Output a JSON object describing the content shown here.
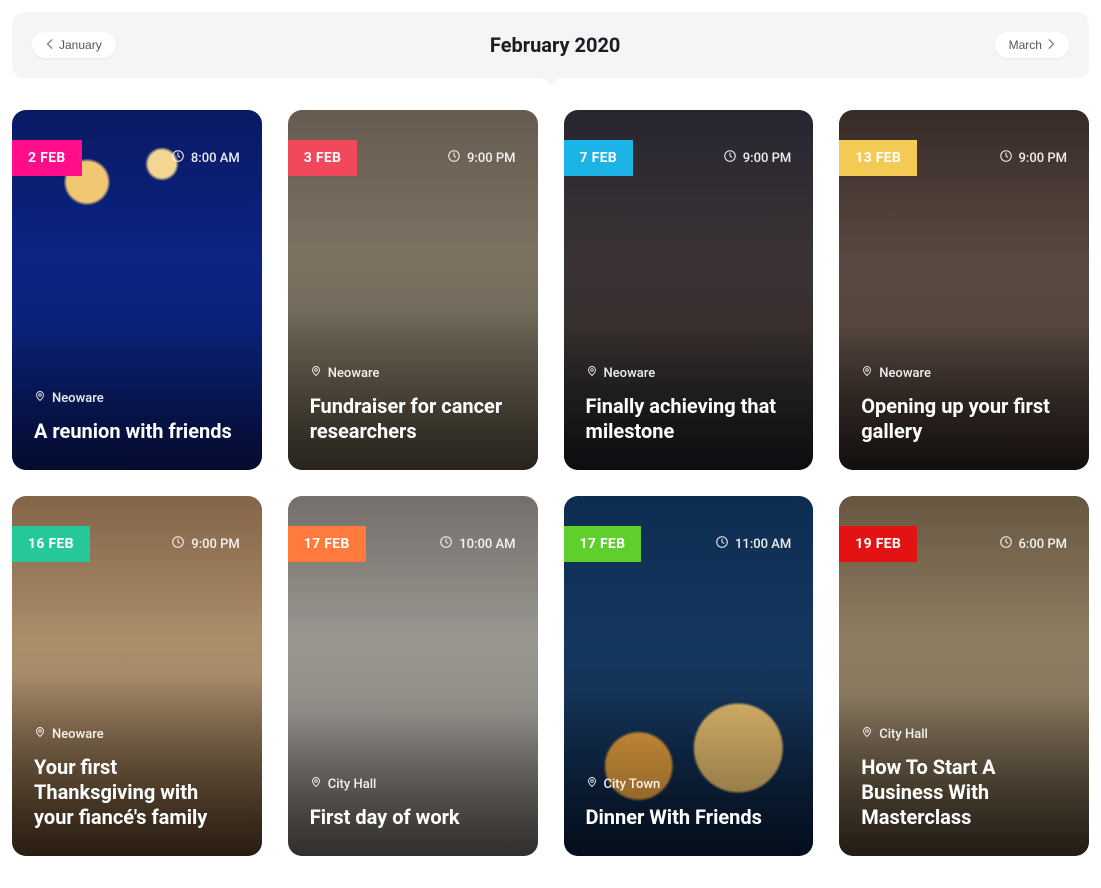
{
  "header": {
    "prev_label": "January",
    "title": "February 2020",
    "next_label": "March"
  },
  "tag_colors": {
    "pink": "#ff0d8a",
    "coral": "#f2485c",
    "blue": "#1cb3e6",
    "gold": "#f3ca53",
    "teal": "#26c89a",
    "orange": "#ff7a3c",
    "green": "#5fcf2e",
    "red": "#e41313"
  },
  "events": [
    {
      "date": "2 FEB",
      "time": "8:00 AM",
      "location": "Neoware",
      "title": "A reunion with friends",
      "color_key": "pink",
      "bg": "bg0"
    },
    {
      "date": "3 FEB",
      "time": "9:00 PM",
      "location": "Neoware",
      "title": "Fundraiser for cancer researchers",
      "color_key": "coral",
      "bg": "bg1"
    },
    {
      "date": "7 FEB",
      "time": "9:00 PM",
      "location": "Neoware",
      "title": "Finally achieving that milestone",
      "color_key": "blue",
      "bg": "bg2"
    },
    {
      "date": "13 FEB",
      "time": "9:00 PM",
      "location": "Neoware",
      "title": "Opening up your first gallery",
      "color_key": "gold",
      "bg": "bg3"
    },
    {
      "date": "16 FEB",
      "time": "9:00 PM",
      "location": "Neoware",
      "title": "Your first Thanksgiving with your fiancé's family",
      "color_key": "teal",
      "bg": "bg4"
    },
    {
      "date": "17 FEB",
      "time": "10:00 AM",
      "location": "City Hall",
      "title": "First day of work",
      "color_key": "orange",
      "bg": "bg5"
    },
    {
      "date": "17 FEB",
      "time": "11:00 AM",
      "location": "City Town",
      "title": "Dinner With Friends",
      "color_key": "green",
      "bg": "bg6"
    },
    {
      "date": "19 FEB",
      "time": "6:00 PM",
      "location": "City Hall",
      "title": "How To Start A Business With Masterclass",
      "color_key": "red",
      "bg": "bg7"
    }
  ]
}
